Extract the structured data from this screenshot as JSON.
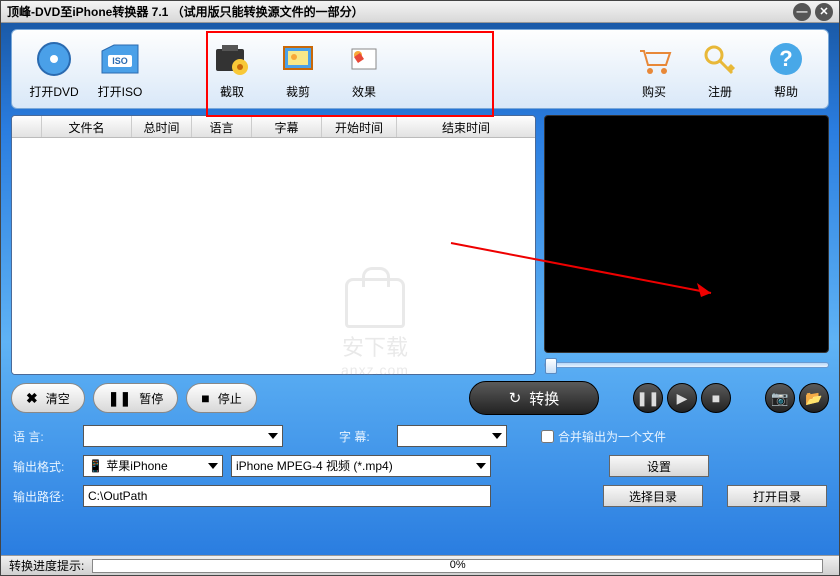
{
  "title": "顶峰-DVD至iPhone转换器 7.1 （试用版只能转换源文件的一部分）",
  "toolbar": {
    "open_dvd": "打开DVD",
    "open_iso": "打开ISO",
    "capture": "截取",
    "crop": "裁剪",
    "effect": "效果",
    "buy": "购买",
    "register": "注册",
    "help": "帮助"
  },
  "columns": {
    "filename": "文件名",
    "duration": "总时间",
    "language": "语言",
    "subtitle": "字幕",
    "start": "开始时间",
    "end": "结束时间"
  },
  "buttons": {
    "clear": "清空",
    "pause": "暂停",
    "stop": "停止",
    "convert": "转换",
    "settings": "设置",
    "choose_dir": "选择目录",
    "open_dir": "打开目录"
  },
  "labels": {
    "language": "语 言:",
    "subtitle": "字 幕:",
    "output_format": "输出格式:",
    "output_path": "输出路径:",
    "merge": "合并输出为一个文件",
    "progress_hint": "转换进度提示:"
  },
  "values": {
    "language": "",
    "subtitle": "",
    "device": "苹果iPhone",
    "format": "iPhone MPEG-4 视频 (*.mp4)",
    "path": "C:\\OutPath",
    "progress": "0%"
  },
  "watermark": {
    "line1": "安下载",
    "line2": "anxz.com"
  }
}
